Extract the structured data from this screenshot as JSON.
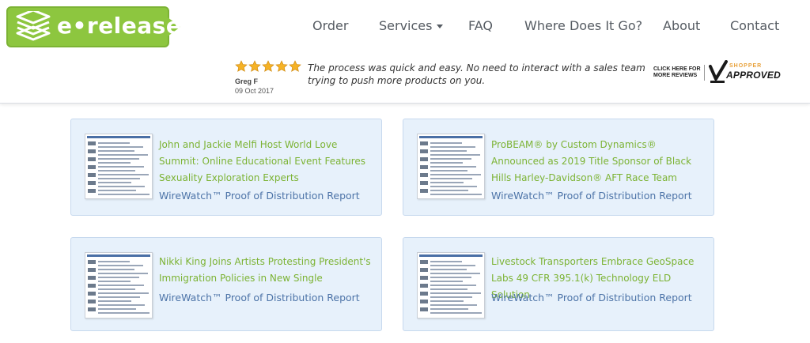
{
  "brand": {
    "name": "e•releases",
    "color": "#8dc63f"
  },
  "nav": [
    {
      "label": "Order",
      "id": "order"
    },
    {
      "label": "Services",
      "id": "services",
      "dropdown": true
    },
    {
      "label": "FAQ",
      "id": "faq"
    },
    {
      "label": "Where Does It Go?",
      "id": "where"
    },
    {
      "label": "About",
      "id": "about"
    },
    {
      "label": "Contact",
      "id": "contact"
    }
  ],
  "review": {
    "rating": 5,
    "reviewer": "Greg F",
    "date": "09 Oct 2017",
    "quote": "The process was quick and easy. No need to interact with a sales team trying to push more products on you."
  },
  "shopper_approved": {
    "click_text": "CLICK HERE FOR MORE REVIEWS",
    "shopper": "SHOPPER",
    "approved": "APPROVED"
  },
  "cards": [
    {
      "title": "John and Jackie Melfi Host World Love Summit: Online Educational Event Features Sexuality Exploration Experts",
      "link": "WireWatch™ Proof of Distribution Report"
    },
    {
      "title": "ProBEAM® by Custom Dynamics® Announced as 2019 Title Sponsor of Black Hills Harley-Davidson® AFT Race Team",
      "link": "WireWatch™ Proof of Distribution Report"
    },
    {
      "title": "Nikki King Joins Artists Protesting President's Immigration Policies in New Single",
      "link": "WireWatch™ Proof of Distribution Report"
    },
    {
      "title": "Livestock Transporters Embrace GeoSpace Labs 49 CFR 395.1(k) Technology ELD Solution",
      "link": "WireWatch™ Proof of Distribution Report"
    }
  ],
  "colors": {
    "title_green": "#7cb334",
    "link_blue": "#4d74a8",
    "card_bg": "#e7f1fb",
    "star_gold": "#f5b225"
  }
}
